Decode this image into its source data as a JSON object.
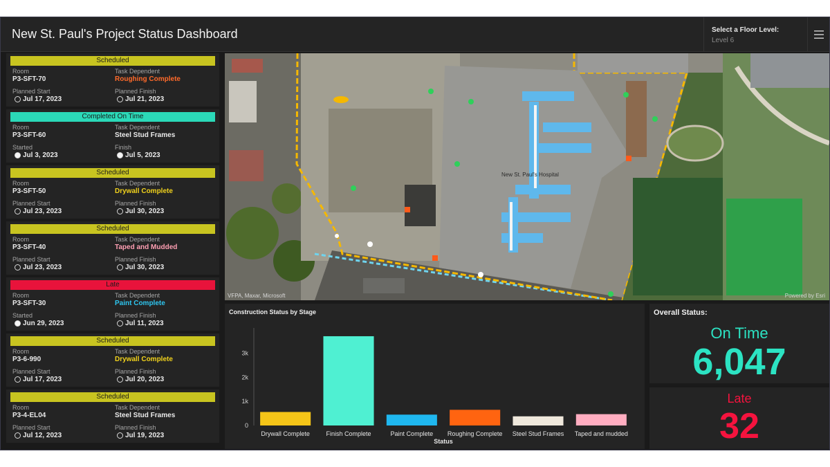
{
  "header": {
    "title": "New St. Paul's Project Status Dashboard",
    "floor_select_label": "Select a Floor Level:",
    "floor_select_value": "Level 6",
    "menu_icon": "hamburger-menu-icon"
  },
  "tasks": [
    {
      "status": "Scheduled",
      "status_color": "#c8c420",
      "room_label": "Room",
      "room": "P3-SFT-70",
      "dep_label": "Task Dependent",
      "dependent": "Roughing Complete",
      "dep_color": "#ff6a2a",
      "start_label": "Planned Start",
      "start": "Jul 17, 2023",
      "finish_label": "Planned Finish",
      "finish": "Jul 21, 2023",
      "start_filled": false,
      "finish_filled": false
    },
    {
      "status": "Completed On Time",
      "status_color": "#2bd9b8",
      "room_label": "Room",
      "room": "P3-SFT-60",
      "dep_label": "Task Dependent",
      "dependent": "Steel Stud Frames",
      "dep_color": "#eaeaea",
      "start_label": "Started",
      "start": "Jul 3, 2023",
      "finish_label": "Finish",
      "finish": "Jul 5, 2023",
      "start_filled": true,
      "finish_filled": true
    },
    {
      "status": "Scheduled",
      "status_color": "#c8c420",
      "room_label": "Room",
      "room": "P3-SFT-50",
      "dep_label": "Task Dependent",
      "dependent": "Drywall Complete",
      "dep_color": "#f1d21c",
      "start_label": "Planned Start",
      "start": "Jul 23, 2023",
      "finish_label": "Planned Finish",
      "finish": "Jul 30, 2023",
      "start_filled": false,
      "finish_filled": false
    },
    {
      "status": "Scheduled",
      "status_color": "#c8c420",
      "room_label": "Room",
      "room": "P3-SFT-40",
      "dep_label": "Task Dependent",
      "dependent": "Taped and Mudded",
      "dep_color": "#ff9fb3",
      "start_label": "Planned Start",
      "start": "Jul 23, 2023",
      "finish_label": "Planned Finish",
      "finish": "Jul 30, 2023",
      "start_filled": false,
      "finish_filled": false
    },
    {
      "status": "Late",
      "status_color": "#e8133b",
      "room_label": "Room",
      "room": "P3-SFT-30",
      "dep_label": "Task Dependent",
      "dependent": "Paint Complete",
      "dep_color": "#2ec6f0",
      "start_label": "Started",
      "start": "Jun 29, 2023",
      "finish_label": "Planned Finish",
      "finish": "Jul 11, 2023",
      "start_filled": true,
      "finish_filled": false
    },
    {
      "status": "Scheduled",
      "status_color": "#c8c420",
      "room_label": "Room",
      "room": "P3-6-990",
      "dep_label": "Task Dependent",
      "dependent": "Drywall Complete",
      "dep_color": "#f1d21c",
      "start_label": "Planned Start",
      "start": "Jul 17, 2023",
      "finish_label": "Planned Finish",
      "finish": "Jul 20, 2023",
      "start_filled": false,
      "finish_filled": false
    },
    {
      "status": "Scheduled",
      "status_color": "#c8c420",
      "room_label": "Room",
      "room": "P3-4-EL04",
      "dep_label": "Task Dependent",
      "dependent": "Steel Stud Frames",
      "dep_color": "#eaeaea",
      "start_label": "Planned Start",
      "start": "Jul 12, 2023",
      "finish_label": "Planned Finish",
      "finish": "Jul 19, 2023",
      "start_filled": false,
      "finish_filled": false
    }
  ],
  "map": {
    "building_label": "New St. Paul's Hospital",
    "attribution_left": "VFPA, Maxar, Microsoft",
    "attribution_right": "Powered by Esri"
  },
  "chart_data": {
    "type": "bar",
    "title": "Construction Status by Stage",
    "xlabel": "Status",
    "ylabel": "",
    "categories": [
      "Drywall Complete",
      "Finish Complete",
      "Paint Complete",
      "Roughing Complete",
      "Steel Stud Frames",
      "Taped and mudded"
    ],
    "values": [
      560,
      3700,
      450,
      650,
      380,
      470
    ],
    "colors": [
      "#f5c518",
      "#4ff0d2",
      "#1fb7ef",
      "#ff6410",
      "#efe8dc",
      "#ffadc0"
    ],
    "yticks": [
      0,
      1000,
      2000,
      3000
    ],
    "ytick_labels": [
      "0",
      "1k",
      "2k",
      "3k"
    ],
    "ylim": [
      0,
      3900
    ],
    "grid": false
  },
  "overall": {
    "title": "Overall Status:",
    "on_time_label": "On Time",
    "on_time_value": "6,047",
    "late_label": "Late",
    "late_value": "32"
  }
}
